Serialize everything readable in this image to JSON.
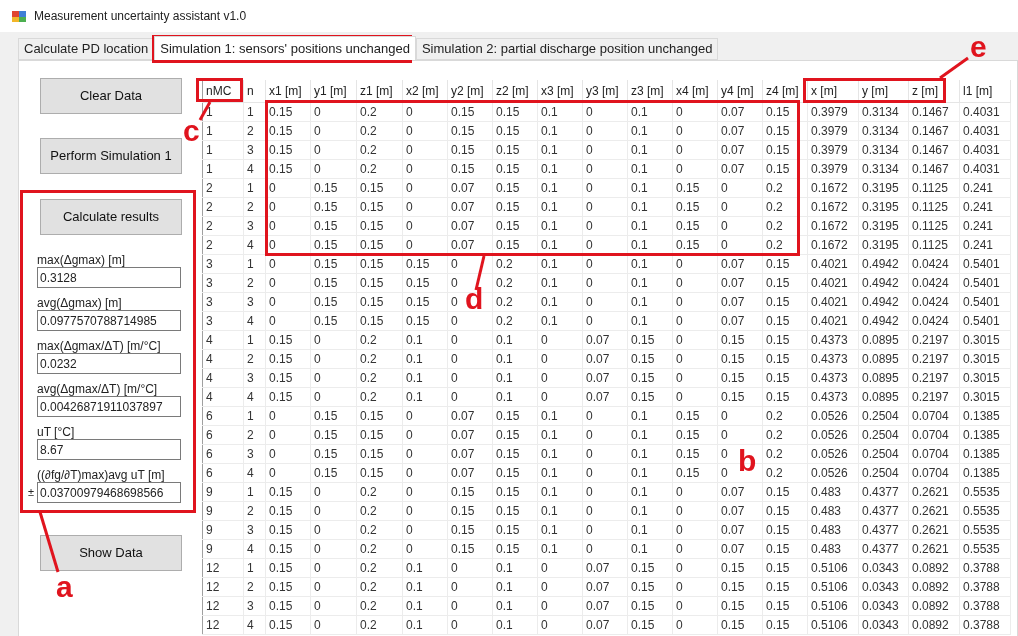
{
  "window": {
    "title": "Measurement uncertainty assistant v1.0"
  },
  "tabs": [
    {
      "label": "Calculate PD location",
      "selected": false
    },
    {
      "label": "Simulation 1: sensors' positions unchanged",
      "selected": true
    },
    {
      "label": "Simulation 2: partial discharge position unchanged",
      "selected": false
    }
  ],
  "buttons": {
    "clear": "Clear Data",
    "perform": "Perform Simulation 1",
    "calculate": "Calculate results",
    "show": "Show Data"
  },
  "results": [
    {
      "label": "max(Δgmax) [m]",
      "value": "0.3128"
    },
    {
      "label": "avg(Δgmax) [m]",
      "value": "0.0977570788714985"
    },
    {
      "label": "max(Δgmax/ΔT) [m/°C]",
      "value": "0.0232"
    },
    {
      "label": "avg(Δgmax/ΔT) [m/°C]",
      "value": "0.00426871911037897"
    },
    {
      "label": "uT [°C]",
      "value": "8.67"
    },
    {
      "label": "((∂fg/∂T)max)avg uT [m]",
      "prefix": "±",
      "value": "0.03700979468698566"
    }
  ],
  "table": {
    "columns": [
      "nMC",
      "n",
      "x1 [m]",
      "y1 [m]",
      "z1 [m]",
      "x2 [m]",
      "y2 [m]",
      "z2 [m]",
      "x3 [m]",
      "y3 [m]",
      "z3 [m]",
      "x4 [m]",
      "y4 [m]",
      "z4 [m]",
      "x [m]",
      "y [m]",
      "z [m]",
      "l1 [m]"
    ],
    "rows": [
      [
        "1",
        "1",
        "0.15",
        "0",
        "0.2",
        "0",
        "0.15",
        "0.15",
        "0.1",
        "0",
        "0.1",
        "0",
        "0.07",
        "0.15",
        "0.3979",
        "0.3134",
        "0.1467",
        "0.4031"
      ],
      [
        "1",
        "2",
        "0.15",
        "0",
        "0.2",
        "0",
        "0.15",
        "0.15",
        "0.1",
        "0",
        "0.1",
        "0",
        "0.07",
        "0.15",
        "0.3979",
        "0.3134",
        "0.1467",
        "0.4031"
      ],
      [
        "1",
        "3",
        "0.15",
        "0",
        "0.2",
        "0",
        "0.15",
        "0.15",
        "0.1",
        "0",
        "0.1",
        "0",
        "0.07",
        "0.15",
        "0.3979",
        "0.3134",
        "0.1467",
        "0.4031"
      ],
      [
        "1",
        "4",
        "0.15",
        "0",
        "0.2",
        "0",
        "0.15",
        "0.15",
        "0.1",
        "0",
        "0.1",
        "0",
        "0.07",
        "0.15",
        "0.3979",
        "0.3134",
        "0.1467",
        "0.4031"
      ],
      [
        "2",
        "1",
        "0",
        "0.15",
        "0.15",
        "0",
        "0.07",
        "0.15",
        "0.1",
        "0",
        "0.1",
        "0.15",
        "0",
        "0.2",
        "0.1672",
        "0.3195",
        "0.1125",
        "0.241"
      ],
      [
        "2",
        "2",
        "0",
        "0.15",
        "0.15",
        "0",
        "0.07",
        "0.15",
        "0.1",
        "0",
        "0.1",
        "0.15",
        "0",
        "0.2",
        "0.1672",
        "0.3195",
        "0.1125",
        "0.241"
      ],
      [
        "2",
        "3",
        "0",
        "0.15",
        "0.15",
        "0",
        "0.07",
        "0.15",
        "0.1",
        "0",
        "0.1",
        "0.15",
        "0",
        "0.2",
        "0.1672",
        "0.3195",
        "0.1125",
        "0.241"
      ],
      [
        "2",
        "4",
        "0",
        "0.15",
        "0.15",
        "0",
        "0.07",
        "0.15",
        "0.1",
        "0",
        "0.1",
        "0.15",
        "0",
        "0.2",
        "0.1672",
        "0.3195",
        "0.1125",
        "0.241"
      ],
      [
        "3",
        "1",
        "0",
        "0.15",
        "0.15",
        "0.15",
        "0",
        "0.2",
        "0.1",
        "0",
        "0.1",
        "0",
        "0.07",
        "0.15",
        "0.4021",
        "0.4942",
        "0.0424",
        "0.5401"
      ],
      [
        "3",
        "2",
        "0",
        "0.15",
        "0.15",
        "0.15",
        "0",
        "0.2",
        "0.1",
        "0",
        "0.1",
        "0",
        "0.07",
        "0.15",
        "0.4021",
        "0.4942",
        "0.0424",
        "0.5401"
      ],
      [
        "3",
        "3",
        "0",
        "0.15",
        "0.15",
        "0.15",
        "0",
        "0.2",
        "0.1",
        "0",
        "0.1",
        "0",
        "0.07",
        "0.15",
        "0.4021",
        "0.4942",
        "0.0424",
        "0.5401"
      ],
      [
        "3",
        "4",
        "0",
        "0.15",
        "0.15",
        "0.15",
        "0",
        "0.2",
        "0.1",
        "0",
        "0.1",
        "0",
        "0.07",
        "0.15",
        "0.4021",
        "0.4942",
        "0.0424",
        "0.5401"
      ],
      [
        "4",
        "1",
        "0.15",
        "0",
        "0.2",
        "0.1",
        "0",
        "0.1",
        "0",
        "0.07",
        "0.15",
        "0",
        "0.15",
        "0.15",
        "0.4373",
        "0.0895",
        "0.2197",
        "0.3015"
      ],
      [
        "4",
        "2",
        "0.15",
        "0",
        "0.2",
        "0.1",
        "0",
        "0.1",
        "0",
        "0.07",
        "0.15",
        "0",
        "0.15",
        "0.15",
        "0.4373",
        "0.0895",
        "0.2197",
        "0.3015"
      ],
      [
        "4",
        "3",
        "0.15",
        "0",
        "0.2",
        "0.1",
        "0",
        "0.1",
        "0",
        "0.07",
        "0.15",
        "0",
        "0.15",
        "0.15",
        "0.4373",
        "0.0895",
        "0.2197",
        "0.3015"
      ],
      [
        "4",
        "4",
        "0.15",
        "0",
        "0.2",
        "0.1",
        "0",
        "0.1",
        "0",
        "0.07",
        "0.15",
        "0",
        "0.15",
        "0.15",
        "0.4373",
        "0.0895",
        "0.2197",
        "0.3015"
      ],
      [
        "6",
        "1",
        "0",
        "0.15",
        "0.15",
        "0",
        "0.07",
        "0.15",
        "0.1",
        "0",
        "0.1",
        "0.15",
        "0",
        "0.2",
        "0.0526",
        "0.2504",
        "0.0704",
        "0.1385"
      ],
      [
        "6",
        "2",
        "0",
        "0.15",
        "0.15",
        "0",
        "0.07",
        "0.15",
        "0.1",
        "0",
        "0.1",
        "0.15",
        "0",
        "0.2",
        "0.0526",
        "0.2504",
        "0.0704",
        "0.1385"
      ],
      [
        "6",
        "3",
        "0",
        "0.15",
        "0.15",
        "0",
        "0.07",
        "0.15",
        "0.1",
        "0",
        "0.1",
        "0.15",
        "0",
        "0.2",
        "0.0526",
        "0.2504",
        "0.0704",
        "0.1385"
      ],
      [
        "6",
        "4",
        "0",
        "0.15",
        "0.15",
        "0",
        "0.07",
        "0.15",
        "0.1",
        "0",
        "0.1",
        "0.15",
        "0",
        "0.2",
        "0.0526",
        "0.2504",
        "0.0704",
        "0.1385"
      ],
      [
        "9",
        "1",
        "0.15",
        "0",
        "0.2",
        "0",
        "0.15",
        "0.15",
        "0.1",
        "0",
        "0.1",
        "0",
        "0.07",
        "0.15",
        "0.483",
        "0.4377",
        "0.2621",
        "0.5535"
      ],
      [
        "9",
        "2",
        "0.15",
        "0",
        "0.2",
        "0",
        "0.15",
        "0.15",
        "0.1",
        "0",
        "0.1",
        "0",
        "0.07",
        "0.15",
        "0.483",
        "0.4377",
        "0.2621",
        "0.5535"
      ],
      [
        "9",
        "3",
        "0.15",
        "0",
        "0.2",
        "0",
        "0.15",
        "0.15",
        "0.1",
        "0",
        "0.1",
        "0",
        "0.07",
        "0.15",
        "0.483",
        "0.4377",
        "0.2621",
        "0.5535"
      ],
      [
        "9",
        "4",
        "0.15",
        "0",
        "0.2",
        "0",
        "0.15",
        "0.15",
        "0.1",
        "0",
        "0.1",
        "0",
        "0.07",
        "0.15",
        "0.483",
        "0.4377",
        "0.2621",
        "0.5535"
      ],
      [
        "12",
        "1",
        "0.15",
        "0",
        "0.2",
        "0.1",
        "0",
        "0.1",
        "0",
        "0.07",
        "0.15",
        "0",
        "0.15",
        "0.15",
        "0.5106",
        "0.0343",
        "0.0892",
        "0.3788"
      ],
      [
        "12",
        "2",
        "0.15",
        "0",
        "0.2",
        "0.1",
        "0",
        "0.1",
        "0",
        "0.07",
        "0.15",
        "0",
        "0.15",
        "0.15",
        "0.5106",
        "0.0343",
        "0.0892",
        "0.3788"
      ],
      [
        "12",
        "3",
        "0.15",
        "0",
        "0.2",
        "0.1",
        "0",
        "0.1",
        "0",
        "0.07",
        "0.15",
        "0",
        "0.15",
        "0.15",
        "0.5106",
        "0.0343",
        "0.0892",
        "0.3788"
      ],
      [
        "12",
        "4",
        "0.15",
        "0",
        "0.2",
        "0.1",
        "0",
        "0.1",
        "0",
        "0.07",
        "0.15",
        "0",
        "0.15",
        "0.15",
        "0.5106",
        "0.0343",
        "0.0892",
        "0.3788"
      ]
    ]
  },
  "annotations": [
    {
      "label": "a"
    },
    {
      "label": "b"
    },
    {
      "label": "c"
    },
    {
      "label": "d"
    },
    {
      "label": "e"
    }
  ]
}
